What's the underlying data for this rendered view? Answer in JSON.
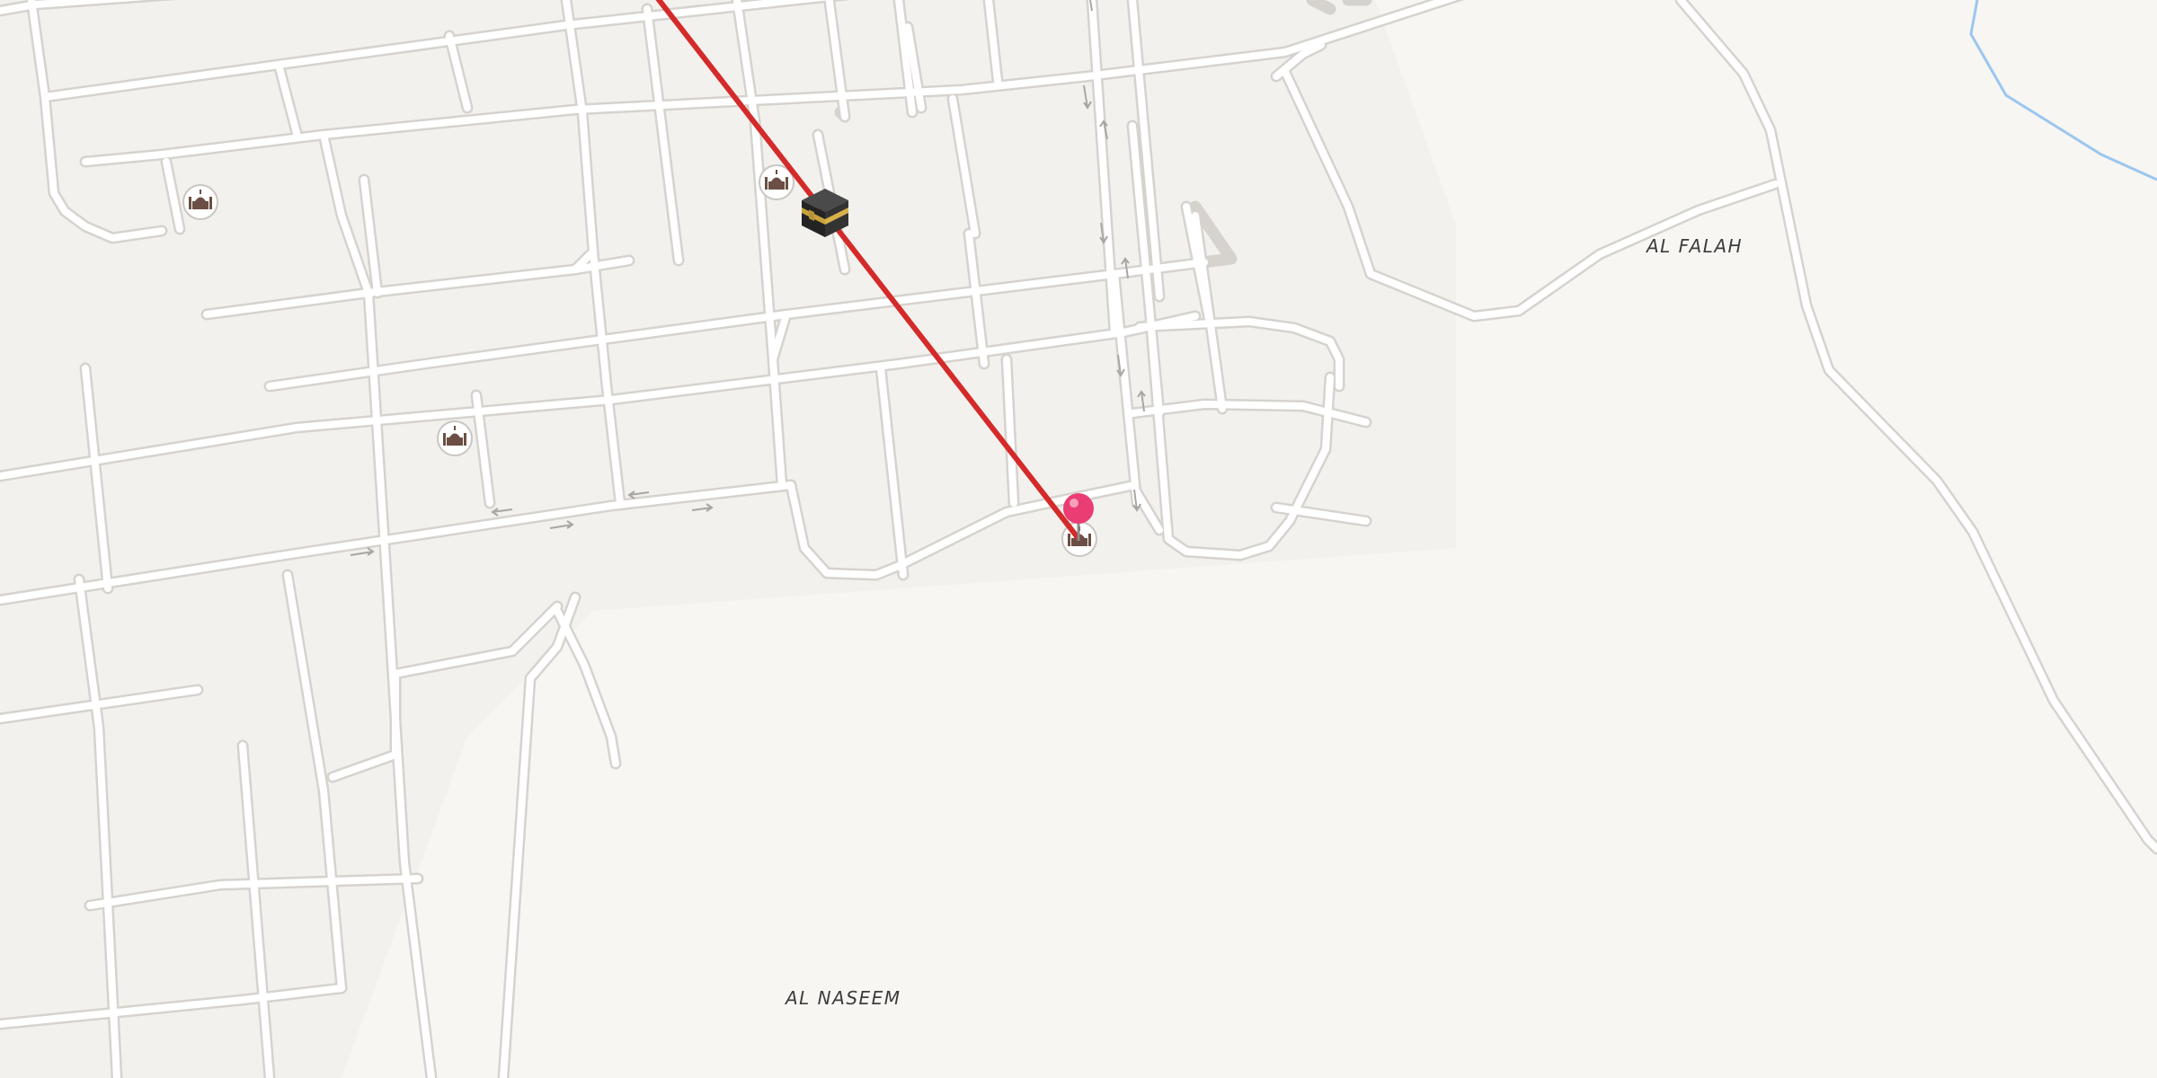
{
  "map": {
    "type": "street-map",
    "labels": {
      "al_falah": "AL FALAH",
      "al_naseem": "AL NASEEM"
    },
    "markers": [
      {
        "kind": "kaaba-icon",
        "name": ""
      },
      {
        "kind": "location-pin-icon",
        "name": ""
      }
    ],
    "poi_icons": [
      "mosque-icon",
      "mosque-icon",
      "mosque-icon",
      "mosque-icon"
    ],
    "route_line": {
      "color": "#d42a2a",
      "description": "qibla direction line"
    },
    "colors": {
      "land": "#f7f6f3",
      "block": "#f3f1ee",
      "road_outline": "#d6d3ce",
      "road_fill": "#ffffff",
      "water": "#9cc6ef",
      "pin": "#ea3d73",
      "kaaba": "#2a2a2a",
      "kaaba_band": "#c8a23a"
    }
  }
}
